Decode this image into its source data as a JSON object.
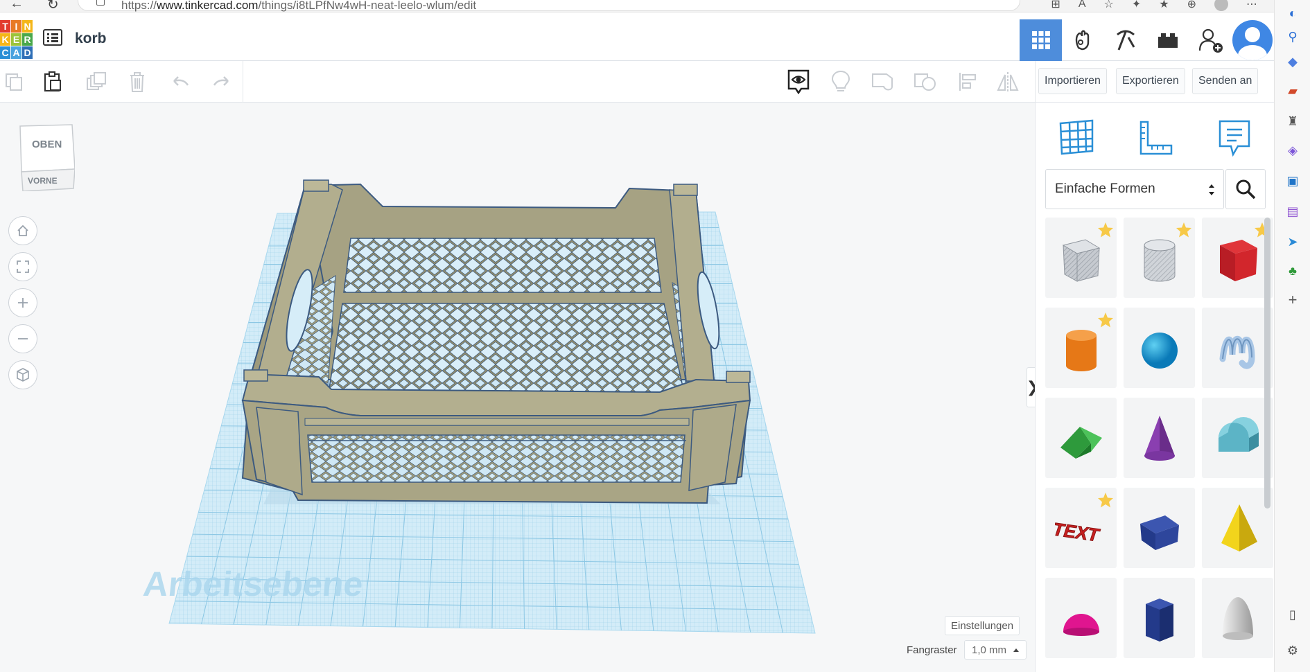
{
  "browser": {
    "url_prefix": "https://",
    "url_domain": "www.tinkercad.com",
    "url_path": "/things/i8tLPfNw4wH-neat-leelo-wlum/edit"
  },
  "app": {
    "logo_letters": [
      "T",
      "I",
      "N",
      "K",
      "E",
      "R",
      "C",
      "A",
      "D"
    ],
    "logo_colors": [
      "#e23b2e",
      "#e87a25",
      "#f4b619",
      "#f4b619",
      "#9cc33a",
      "#4aa84b",
      "#2a8fd6",
      "#4aa3df",
      "#2e6fb7"
    ],
    "design_title": "korb"
  },
  "toolbar": {
    "import_label": "Importieren",
    "export_label": "Exportieren",
    "send_label": "Senden an"
  },
  "viewcube": {
    "top_label": "OBEN",
    "front_label": "VORNE"
  },
  "workplane": {
    "label": "Arbeitsebene",
    "settings_label": "Einstellungen",
    "snap_label": "Fangraster",
    "snap_value": "1,0 mm"
  },
  "panel": {
    "category": "Einfache Formen",
    "shapes": [
      {
        "name": "Box (Bohrung)",
        "icon": "hole-box-icon",
        "starred": true
      },
      {
        "name": "Zylinder (Bohrung)",
        "icon": "hole-cylinder-icon",
        "starred": true
      },
      {
        "name": "Quader",
        "icon": "box-icon",
        "starred": true
      },
      {
        "name": "Zylinder",
        "icon": "cylinder-icon",
        "starred": true
      },
      {
        "name": "Kugel",
        "icon": "sphere-icon",
        "starred": false
      },
      {
        "name": "Kritzeln",
        "icon": "scribble-icon",
        "starred": false
      },
      {
        "name": "Dach",
        "icon": "roof-icon",
        "starred": false
      },
      {
        "name": "Kegel",
        "icon": "cone-icon",
        "starred": false
      },
      {
        "name": "Runddach",
        "icon": "round-roof-icon",
        "starred": false
      },
      {
        "name": "Text",
        "icon": "text-shape-icon",
        "starred": true,
        "text": "TEXT"
      },
      {
        "name": "Prisma",
        "icon": "prism-icon",
        "starred": false
      },
      {
        "name": "Pyramide",
        "icon": "pyramid-icon",
        "starred": false
      },
      {
        "name": "Halbkugel",
        "icon": "half-sphere-icon",
        "starred": false
      },
      {
        "name": "Polygon",
        "icon": "polygon-icon",
        "starred": false
      },
      {
        "name": "Paraboloid",
        "icon": "paraboloid-icon",
        "starred": false
      }
    ]
  },
  "colors": {
    "accent": "#4e8ddb",
    "workplane": "#bfe3f5",
    "model": "#a9a584",
    "model_edge": "#3c5a80"
  }
}
